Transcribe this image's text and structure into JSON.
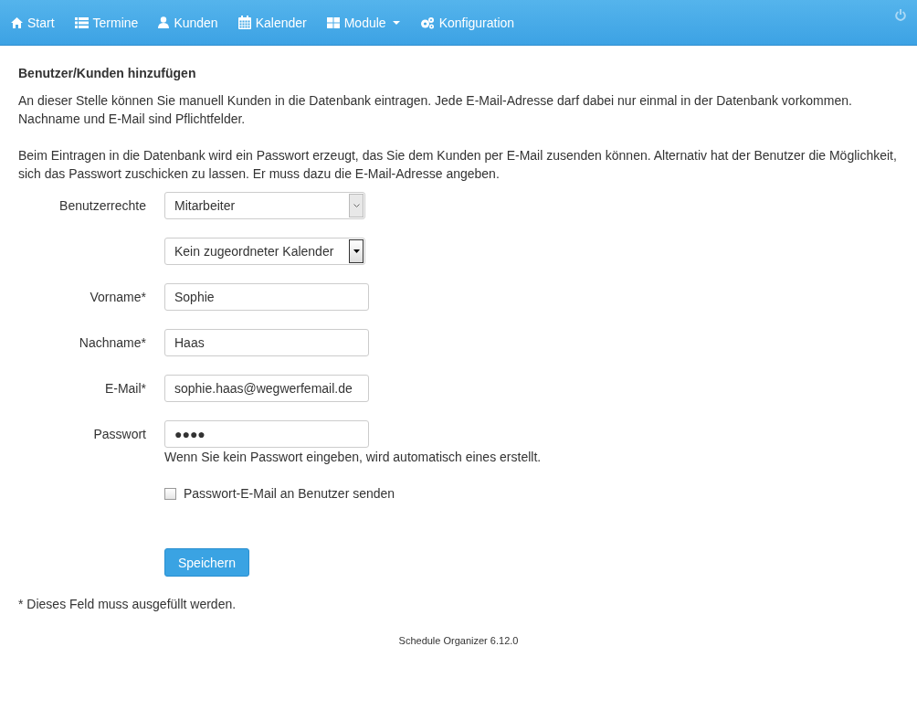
{
  "navbar": {
    "items": [
      {
        "label": "Start",
        "dropdown": false
      },
      {
        "label": "Termine",
        "dropdown": false
      },
      {
        "label": "Kunden",
        "dropdown": false
      },
      {
        "label": "Kalender",
        "dropdown": false
      },
      {
        "label": "Module",
        "dropdown": true
      },
      {
        "label": "Konfiguration",
        "dropdown": false
      }
    ]
  },
  "heading": "Benutzer/Kunden hinzufügen",
  "paragraphs": [
    "An dieser Stelle können Sie manuell Kunden in die Datenbank eintragen. Jede E-Mail-Adresse darf dabei nur einmal in der Datenbank vorkommen. Nachname und E-Mail sind Pflichtfelder.",
    "Beim Eintragen in die Datenbank wird ein Passwort erzeugt, das Sie dem Kunden per E-Mail zusenden können. Alternativ hat der Benutzer die Möglichkeit, sich das Passwort zuschicken zu lassen. Er muss dazu die E-Mail-Adresse angeben."
  ],
  "form": [
    {
      "kind": "select",
      "label": "Benutzerrechte",
      "value": "Mitarbeiter"
    },
    {
      "kind": "select",
      "value": "Kein zugeordneter Kalender"
    },
    {
      "kind": "input",
      "label": "Vorname*",
      "value": "Sophie"
    },
    {
      "kind": "input",
      "label": "Nachname*",
      "value": "Haas"
    },
    {
      "kind": "input",
      "label": "E-Mail*",
      "value": "sophie.haas@wegwerfemail.de"
    },
    {
      "kind": "input",
      "label": "Passwort",
      "value": "●●●●",
      "help": "Wenn Sie kein Passwort eingeben, wird automatisch eines erstellt."
    },
    {
      "kind": "checkbox",
      "label": "Passwort-E-Mail an Benutzer senden",
      "checked": false
    }
  ],
  "save_button": "Speichern",
  "footnote": "* Dieses Feld muss ausgefüllt werden.",
  "footer": "Schedule Organizer 6.12.0"
}
